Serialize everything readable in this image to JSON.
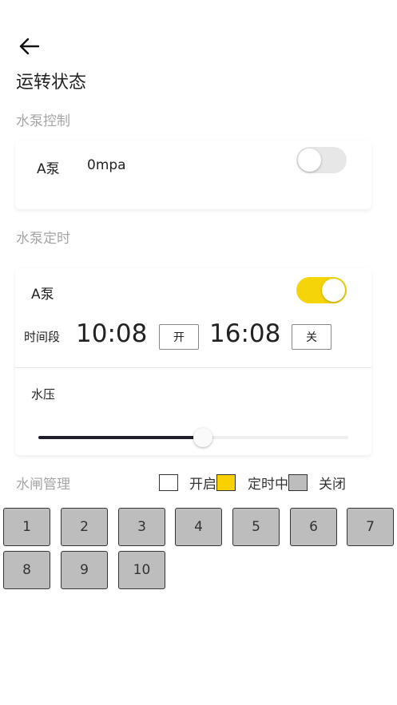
{
  "header": {
    "title": "运转状态"
  },
  "pump_control": {
    "section_label": "水泵控制",
    "pump_name": "A泵",
    "pressure": "0mpa",
    "toggle_on": false
  },
  "pump_timer": {
    "section_label": "水泵定时",
    "pump_name": "A泵",
    "toggle_on": true,
    "time_label": "时间段",
    "start_time": "10:08",
    "start_button": "开",
    "end_time": "16:08",
    "end_button": "关",
    "pressure_label": "水压",
    "pressure_level_percent": 53
  },
  "gate_management": {
    "section_label": "水闸管理",
    "legend": [
      {
        "label": "开启",
        "color": "#ffffff"
      },
      {
        "label": "定时中",
        "color": "#f9d000"
      },
      {
        "label": "关闭",
        "color": "#bdbdbd"
      }
    ],
    "gates": [
      "1",
      "2",
      "3",
      "4",
      "5",
      "6",
      "7",
      "8",
      "9",
      "10"
    ]
  },
  "colors": {
    "accent": "#f5d409",
    "closed": "#bdbdbd",
    "slider_fill": "#1d1d2b"
  }
}
